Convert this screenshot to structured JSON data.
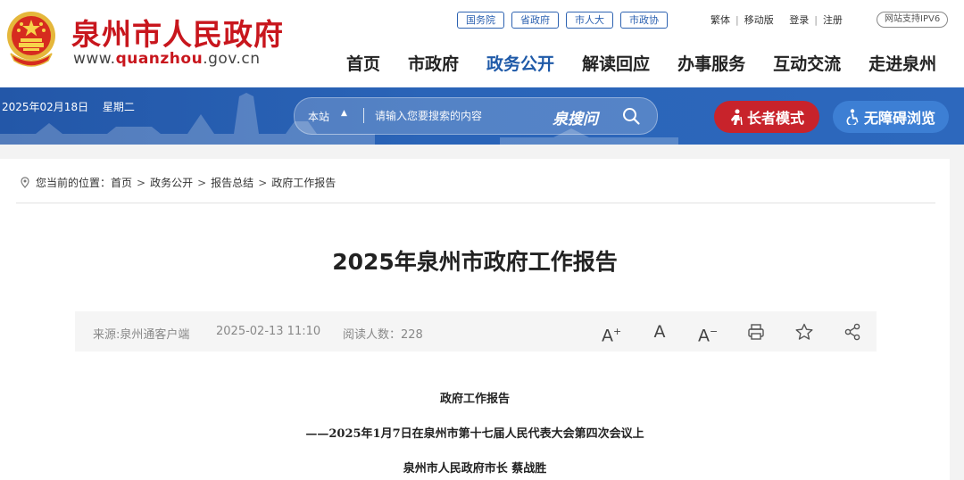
{
  "header": {
    "site_name": "泉州市人民政府",
    "site_url_prefix": "www.",
    "site_url_highlight": "quanzhou",
    "site_url_suffix": ".gov.cn",
    "top_links": [
      "国务院",
      "省政府",
      "市人大",
      "市政协"
    ],
    "util_links": [
      "繁体",
      "移动版",
      "登录",
      "注册"
    ],
    "ipv6": "网站支持IPV6",
    "nav": [
      "首页",
      "市政府",
      "政务公开",
      "解读回应",
      "办事服务",
      "互动交流",
      "走进泉州"
    ],
    "nav_active_index": 2
  },
  "banner": {
    "date": "2025年02月18日",
    "weekday": "星期二",
    "search_scope": "本站",
    "search_placeholder": "请输入您要搜索的内容",
    "search_brand": "泉搜问",
    "elder_mode": "长者模式",
    "accessible": "无障碍浏览"
  },
  "breadcrumb": {
    "prefix": "您当前的位置：",
    "items": [
      "首页",
      "政务公开",
      "报告总结",
      "政府工作报告"
    ]
  },
  "article": {
    "title": "2025年泉州市政府工作报告",
    "source": "来源:泉州通客户端",
    "datetime": "2025-02-13 11:10",
    "reads_label": "阅读人数：",
    "reads": "228",
    "paragraphs": [
      "政府工作报告",
      "——2025年1月7日在泉州市第十七届人民代表大会第四次会议上",
      "泉州市人民政府市长  蔡战胜"
    ]
  },
  "colors": {
    "brand_red": "#c8161d",
    "nav_active_blue": "#1f5aa8",
    "banner_blue": "#2a64b8",
    "elder_btn": "#c8232b",
    "access_btn": "#3d7fd4"
  }
}
